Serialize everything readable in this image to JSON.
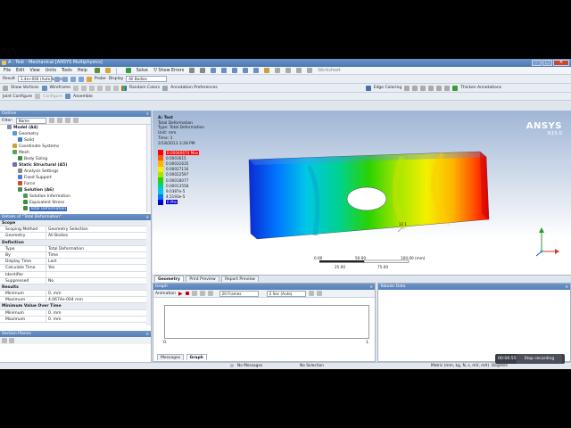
{
  "window": {
    "title": "A : Test - Mechanical [ANSYS Multiphysics]"
  },
  "menu": [
    "File",
    "Edit",
    "View",
    "Units",
    "Tools",
    "Help"
  ],
  "toolbar1": {
    "solve": "Solve",
    "show_errors": "?/ Show Errors",
    "worksheet": "Worksheet"
  },
  "toolbar2": {
    "result_label": "Result",
    "result_scale": "3.4e+004 (Auto Scale)",
    "probe": "Probe",
    "display_label": "Display",
    "display_value": "All Bodies"
  },
  "toolbar3": {
    "show_vertices": "Show Vertices",
    "wireframe": "Wireframe",
    "random_colors": "Random Colors",
    "annotation_prefs": "Annotation Preferences",
    "edge_coloring": "Edge Coloring",
    "thicken_annotations": "Thicken Annotations"
  },
  "toolbar4": {
    "joint_configure": "Joint Configure",
    "configure": "Configure",
    "assemble": "Assemble"
  },
  "outline": {
    "header": "Outline",
    "filter_label": "Filter:",
    "filter_value": "Name",
    "tree": [
      {
        "label": "Model (A4)",
        "bold": true,
        "indent": 1,
        "icon": "model-icon"
      },
      {
        "label": "Geometry",
        "bold": false,
        "indent": 2,
        "icon": "geometry-icon"
      },
      {
        "label": "Solid",
        "bold": false,
        "indent": 3,
        "icon": "solid-icon"
      },
      {
        "label": "Coordinate Systems",
        "bold": false,
        "indent": 2,
        "icon": "coordinate-systems-icon"
      },
      {
        "label": "Mesh",
        "bold": false,
        "indent": 2,
        "icon": "mesh-icon"
      },
      {
        "label": "Body Sizing",
        "bold": false,
        "indent": 3,
        "icon": "sizing-icon"
      },
      {
        "label": "Static Structural (A5)",
        "bold": true,
        "indent": 2,
        "icon": "static-structural-icon"
      },
      {
        "label": "Analysis Settings",
        "bold": false,
        "indent": 3,
        "icon": "analysis-settings-icon"
      },
      {
        "label": "Fixed Support",
        "bold": false,
        "indent": 3,
        "icon": "fixed-support-icon"
      },
      {
        "label": "Force",
        "bold": false,
        "indent": 3,
        "icon": "force-icon"
      },
      {
        "label": "Solution (A6)",
        "bold": true,
        "indent": 3,
        "icon": "solution-icon"
      },
      {
        "label": "Solution Information",
        "bold": false,
        "indent": 4,
        "icon": "solution-information-icon"
      },
      {
        "label": "Equivalent Stress",
        "bold": false,
        "indent": 4,
        "icon": "equivalent-stress-icon"
      },
      {
        "label": "Total Deformation",
        "bold": false,
        "indent": 4,
        "icon": "total-deformation-icon",
        "selected": true
      }
    ]
  },
  "details": {
    "header": "Details of \"Total Deformation\"",
    "rows": [
      {
        "group": true,
        "k": "Scope"
      },
      {
        "k": "Scoping Method",
        "v": "Geometry Selection"
      },
      {
        "k": "Geometry",
        "v": "All Bodies"
      },
      {
        "group": true,
        "k": "Definition"
      },
      {
        "k": "Type",
        "v": "Total Deformation"
      },
      {
        "k": "By",
        "v": "Time"
      },
      {
        "k": "Display Time",
        "v": "Last"
      },
      {
        "k": "Calculate Time History",
        "v": "Yes"
      },
      {
        "k": "Identifier",
        "v": ""
      },
      {
        "k": "Suppressed",
        "v": "No"
      },
      {
        "group": true,
        "k": "Results"
      },
      {
        "k": "Minimum",
        "v": "0. mm"
      },
      {
        "k": "Maximum",
        "v": "4.0674e-004 mm"
      },
      {
        "group": true,
        "k": "Minimum Value Over Time"
      },
      {
        "k": "Minimum",
        "v": "0. mm"
      },
      {
        "k": "Maximum",
        "v": "0. mm"
      }
    ]
  },
  "section_planes": {
    "header": "Section Planes"
  },
  "viewport": {
    "info": [
      "A: Test",
      "Total Deformation",
      "Type: Total Deformation",
      "Unit: mm",
      "Time: 1",
      "2/18/2013 3:28 PM"
    ],
    "legend": [
      {
        "label": "0.00040674 Max",
        "color": "#ff0000"
      },
      {
        "label": "0.0003615",
        "color": "#ff5a00"
      },
      {
        "label": "0.00031635",
        "color": "#ffb300"
      },
      {
        "label": "0.00027116",
        "color": "#f3f000"
      },
      {
        "label": "0.00022597",
        "color": "#a5e600"
      },
      {
        "label": "0.00018077",
        "color": "#2ad200"
      },
      {
        "label": "0.00013558",
        "color": "#00d28c"
      },
      {
        "label": "9.0387e-5",
        "color": "#00c8e6"
      },
      {
        "label": "4.5193e-5",
        "color": "#0078ff"
      },
      {
        "label": "0 Min",
        "color": "#0000d0"
      }
    ],
    "logo": "ANSYS",
    "version": "R15.0",
    "scale_top": [
      "0.00",
      "50.00",
      "100.00 (mm)"
    ],
    "scale_bottom": [
      "25.00",
      "75.00"
    ],
    "probe_label": "12.1"
  },
  "viewtabs": [
    "Geometry",
    "Print Preview",
    "Report Preview"
  ],
  "graph": {
    "header": "Graph",
    "animation_label": "Animation",
    "frames": "20 Frames",
    "duration": "2 Sec (Auto)",
    "x_start": "0.",
    "x_end": "1.",
    "tabs": [
      "Messages",
      "Graph"
    ]
  },
  "tabular": {
    "header": "Tabular Data"
  },
  "status": {
    "messages": "No Messages",
    "selection": "No Selection",
    "units": "Metric (mm, kg, N, s, mV, mA)",
    "angle": "Degrees"
  },
  "recording": {
    "time": "00:06:55",
    "stop": "Stop recording"
  },
  "colors": {
    "titlebar": "#4b77b0",
    "panel_header": "#55a0d8",
    "viewport_top": "#9fb6d5",
    "selection": "#3a6fc4"
  }
}
